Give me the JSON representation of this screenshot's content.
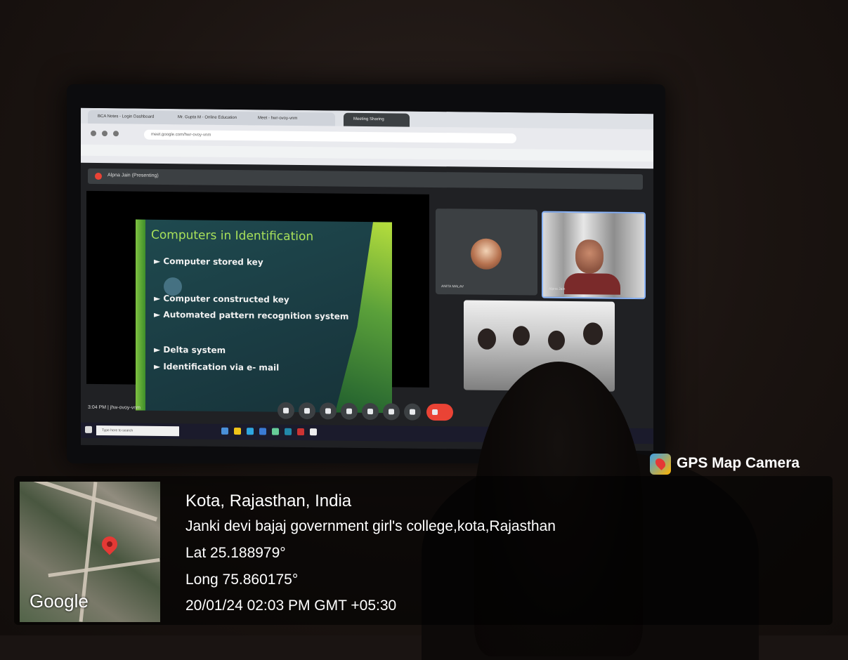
{
  "browser": {
    "tabs": [
      "BCA Notes - Login Dashboard",
      "Mr. Gupta M - Online Education",
      "Meet - hwr-ovoy-vnm",
      "Meeting Sharing"
    ],
    "address": "meet.google.com/hwr-ovoy-vnm"
  },
  "meet": {
    "presenting_label": "Alpna Jain (Presenting)",
    "time_code": "3:04 PM  |  jhw-ovoy-vnm",
    "participants": [
      {
        "name": "ANITA MALAV"
      },
      {
        "name": "Alpna Jain"
      }
    ]
  },
  "slide": {
    "title": "Computers in Identification",
    "bullets": [
      "Computer stored key",
      "Computer constructed key",
      "Automated pattern recognition system",
      "Delta system",
      "Identification via e- mail"
    ],
    "bullet_marker": "►"
  },
  "taskbar": {
    "search_placeholder": "Type here to search"
  },
  "gps": {
    "brand": "GPS Map Camera",
    "map_watermark": "Google",
    "location": "Kota, Rajasthan, India",
    "address": "Janki devi bajaj government girl's college,kota,Rajasthan",
    "lat": "Lat 25.188979°",
    "long": "Long 75.860175°",
    "datetime": "20/01/24 02:03 PM GMT +05:30"
  },
  "colors": {
    "slide_title": "#a8e05a",
    "slide_bg": "#1f4a4f",
    "end_call": "#ea4335",
    "map_pin": "#e53935"
  }
}
